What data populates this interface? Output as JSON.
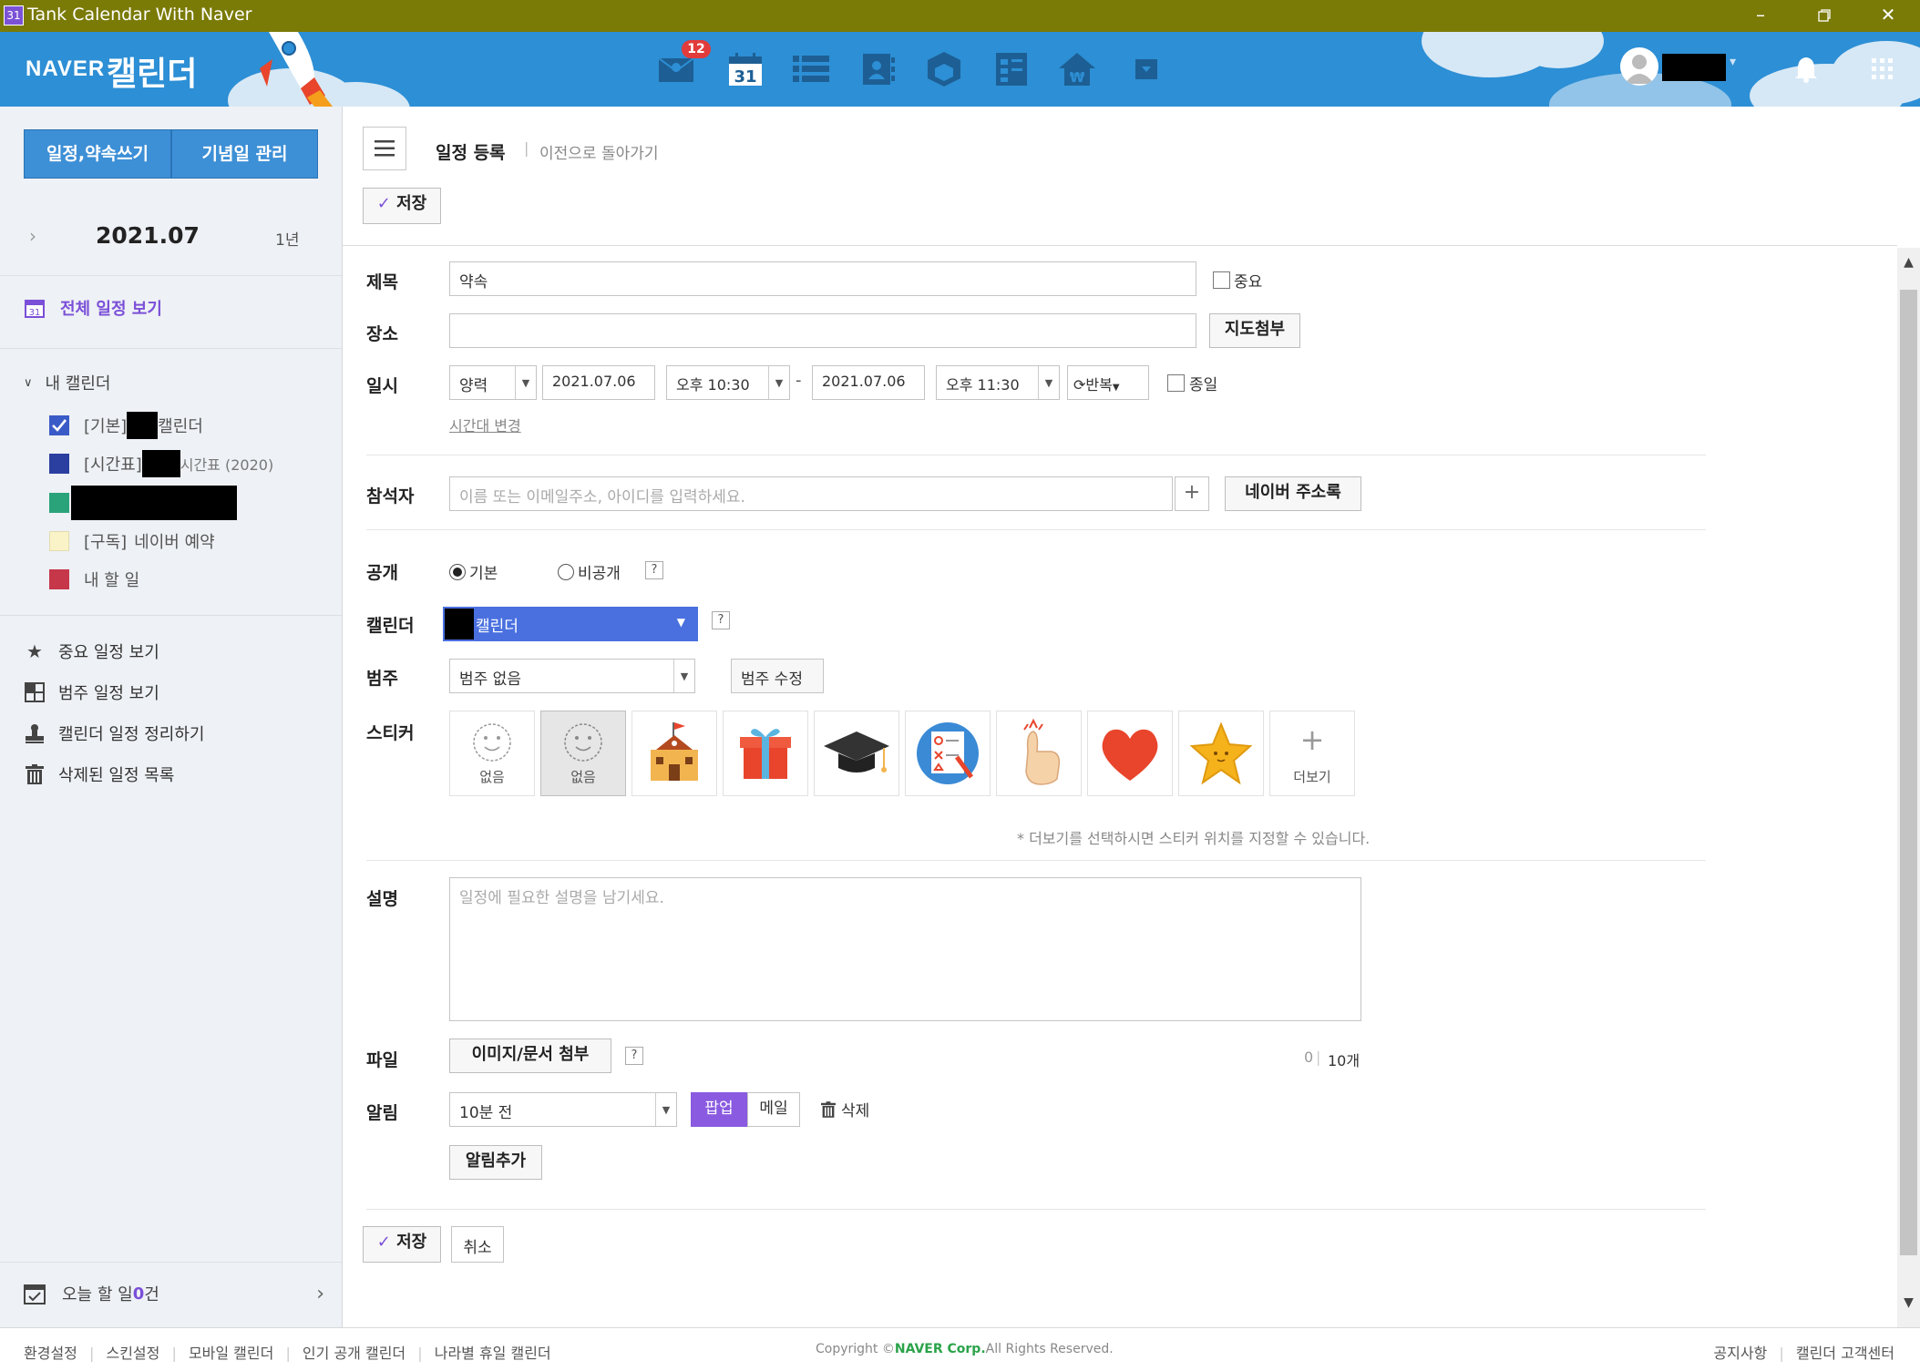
{
  "window": {
    "title": "Tank Calendar With Naver",
    "icon_text": "31",
    "controls": [
      "minimize-icon",
      "restore-icon",
      "close-icon"
    ]
  },
  "header": {
    "logo_naver": "NAVER",
    "logo_calendar": "캘린더",
    "mail_badge": "12",
    "calendar_day": "31",
    "nav_icons": [
      "mail-icon",
      "calendar-icon",
      "list-icon",
      "contacts-icon",
      "cube-icon",
      "memo-icon",
      "house-icon",
      "dropdown-icon"
    ],
    "user_caret": "▾"
  },
  "sidebar": {
    "write_button": "일정,약속쓰기",
    "anniversary_button": "기념일 관리",
    "month": "2021.07",
    "year_toggle": "1년",
    "view_all": "전체 일정 보기",
    "my_calendars_title": "내 캘린더",
    "calendars": [
      {
        "label_a": "[기본]",
        "label_b": "캘린더",
        "color": "#3a5bc7",
        "checked": true
      },
      {
        "label_a": "[시간표]",
        "label_b": "시간표 (2020)",
        "color": "#2b3fa0",
        "checked": false
      },
      {
        "label_a": "",
        "label_b": "",
        "color": "#2aa37a",
        "checked": false
      },
      {
        "label_a": "[구독]",
        "label_b": "네이버 예약",
        "color": "#fbf3c8",
        "checked": false
      },
      {
        "label_a": "",
        "label_b": "내 할 일",
        "color": "#c7374a",
        "checked": false
      }
    ],
    "links": [
      {
        "label": "중요 일정 보기",
        "icon": "star-icon"
      },
      {
        "label": "범주 일정 보기",
        "icon": "category-icon"
      },
      {
        "label": "캘린더 일정 정리하기",
        "icon": "stamp-icon"
      },
      {
        "label": "삭제된 일정 목록",
        "icon": "trash-icon"
      }
    ],
    "todo_prefix": "오늘 할 일 ",
    "todo_count": "0",
    "todo_suffix": "건"
  },
  "page": {
    "title": "일정 등록",
    "back_link": "이전으로 돌아가기",
    "save": "저장",
    "cancel": "취소"
  },
  "form": {
    "labels": {
      "title": "제목",
      "location": "장소",
      "datetime": "일시",
      "attendees": "참석자",
      "visibility": "공개",
      "calendar": "캘린더",
      "category": "범주",
      "sticker": "스티커",
      "description": "설명",
      "file": "파일",
      "alarm": "알림"
    },
    "title_value": "약속",
    "important": "중요",
    "map_attach": "지도첨부",
    "calendar_type": "양력",
    "start_date": "2021.07.06",
    "start_time": "오후 10:30",
    "range_sep": "-",
    "end_date": "2021.07.06",
    "end_time": "오후 11:30",
    "repeat": "반복",
    "all_day": "종일",
    "timezone_link": "시간대 변경",
    "attendee_placeholder": "이름 또는 이메일주소, 아이디를 입력하세요.",
    "address_book": "네이버 주소록",
    "visibility_default": "기본",
    "visibility_private": "비공개",
    "help": "?",
    "calendar_select": "캘린더",
    "category_value": "범주 없음",
    "category_edit": "범주 수정",
    "sticker_none": "없음",
    "sticker_more": "더보기",
    "sticker_hint": "* 더보기를 선택하시면 스티커 위치를 지정할 수 있습니다.",
    "description_placeholder": "일정에 필요한 설명을 남기세요.",
    "file_attach": "이미지/문서 첨부",
    "file_count": "0",
    "file_max": "10개",
    "alarm_value": "10분 전",
    "alarm_popup": "팝업",
    "alarm_mail": "메일",
    "alarm_delete": "삭제",
    "alarm_add": "알림추가"
  },
  "footer": {
    "links": [
      "환경설정",
      "스킨설정",
      "모바일 캘린더",
      "인기 공개 캘린더",
      "나라별 휴일 캘린더"
    ],
    "copyright_a": "Copyright © ",
    "copyright_b": "NAVER Corp.",
    "copyright_c": " All Rights Reserved.",
    "right_links": [
      "공지사항",
      "캘린더 고객센터"
    ]
  },
  "colors": {
    "header_bg": "#2d8fd5",
    "titlebar_bg": "#7a7a06",
    "accent_purple": "#7b4fd8",
    "calendar_select_bg": "#4a70e0",
    "sidebar_bg": "#eef1f5"
  }
}
